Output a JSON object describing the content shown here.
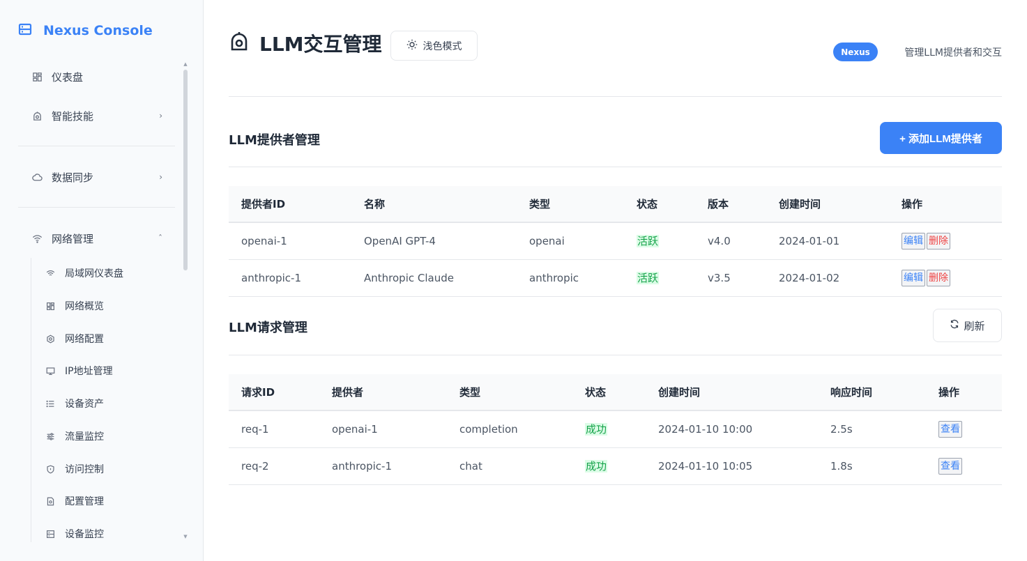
{
  "sidebar": {
    "brand": "Nexus Console",
    "items": [
      {
        "label": "仪表盘",
        "icon": "dashboard-icon"
      },
      {
        "label": "智能技能",
        "icon": "robot-icon",
        "chevron": "›"
      },
      {
        "label": "数据同步",
        "icon": "cloud-icon",
        "chevron": "›"
      },
      {
        "label": "网络管理",
        "icon": "wifi-icon",
        "chevron": "ˆ"
      }
    ],
    "sub_items": [
      {
        "label": "局域网仪表盘",
        "icon": "wifi-icon"
      },
      {
        "label": "网络概览",
        "icon": "grid-icon"
      },
      {
        "label": "网络配置",
        "icon": "settings-icon"
      },
      {
        "label": "IP地址管理",
        "icon": "monitor-icon"
      },
      {
        "label": "设备资产",
        "icon": "list-icon"
      },
      {
        "label": "流量监控",
        "icon": "sliders-icon"
      },
      {
        "label": "访问控制",
        "icon": "shield-icon"
      },
      {
        "label": "配置管理",
        "icon": "file-settings-icon"
      },
      {
        "label": "设备监控",
        "icon": "server-icon"
      }
    ]
  },
  "header": {
    "title": "LLM交互管理",
    "theme_button": "浅色模式",
    "badge": "Nexus",
    "subtitle": "管理LLM提供者和交互"
  },
  "providers": {
    "title": "LLM提供者管理",
    "add_button": "+ 添加LLM提供者",
    "columns": [
      "提供者ID",
      "名称",
      "类型",
      "状态",
      "版本",
      "创建时间",
      "操作"
    ],
    "rows": [
      {
        "id": "openai-1",
        "name": "OpenAI GPT-4",
        "type": "openai",
        "status": "活跃",
        "version": "v4.0",
        "created": "2024-01-01",
        "edit": "编辑",
        "delete": "删除"
      },
      {
        "id": "anthropic-1",
        "name": "Anthropic Claude",
        "type": "anthropic",
        "status": "活跃",
        "version": "v3.5",
        "created": "2024-01-02",
        "edit": "编辑",
        "delete": "删除"
      }
    ]
  },
  "requests": {
    "title": "LLM请求管理",
    "refresh_button": "刷新",
    "columns": [
      "请求ID",
      "提供者",
      "类型",
      "状态",
      "创建时间",
      "响应时间",
      "操作"
    ],
    "rows": [
      {
        "id": "req-1",
        "provider": "openai-1",
        "type": "completion",
        "status": "成功",
        "created": "2024-01-10 10:00",
        "response": "2.5s",
        "view": "查看"
      },
      {
        "id": "req-2",
        "provider": "anthropic-1",
        "type": "chat",
        "status": "成功",
        "created": "2024-01-10 10:05",
        "response": "1.8s",
        "view": "查看"
      }
    ]
  },
  "colors": {
    "accent": "#3b82f6",
    "success_bg": "#dcfce7",
    "success_text": "#16a34a",
    "danger": "#ef4444"
  }
}
